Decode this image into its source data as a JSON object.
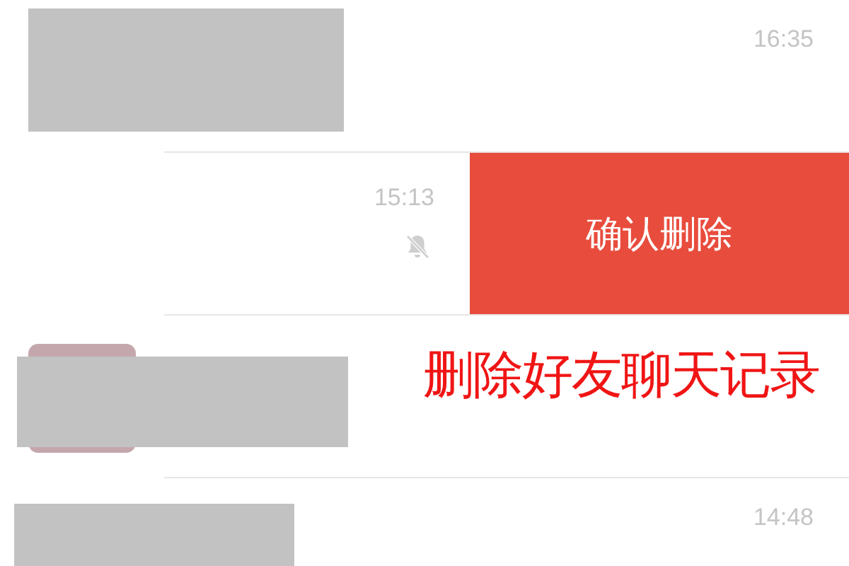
{
  "rows": [
    {
      "time": "16:35",
      "redacted": true
    },
    {
      "time": "15:13",
      "muted": true,
      "swiped": true,
      "delete_label": "确认删除"
    },
    {
      "redacted": true,
      "avatar": true
    },
    {
      "time": "14:48",
      "redacted": true
    }
  ],
  "caption": "删除好友聊天记录"
}
